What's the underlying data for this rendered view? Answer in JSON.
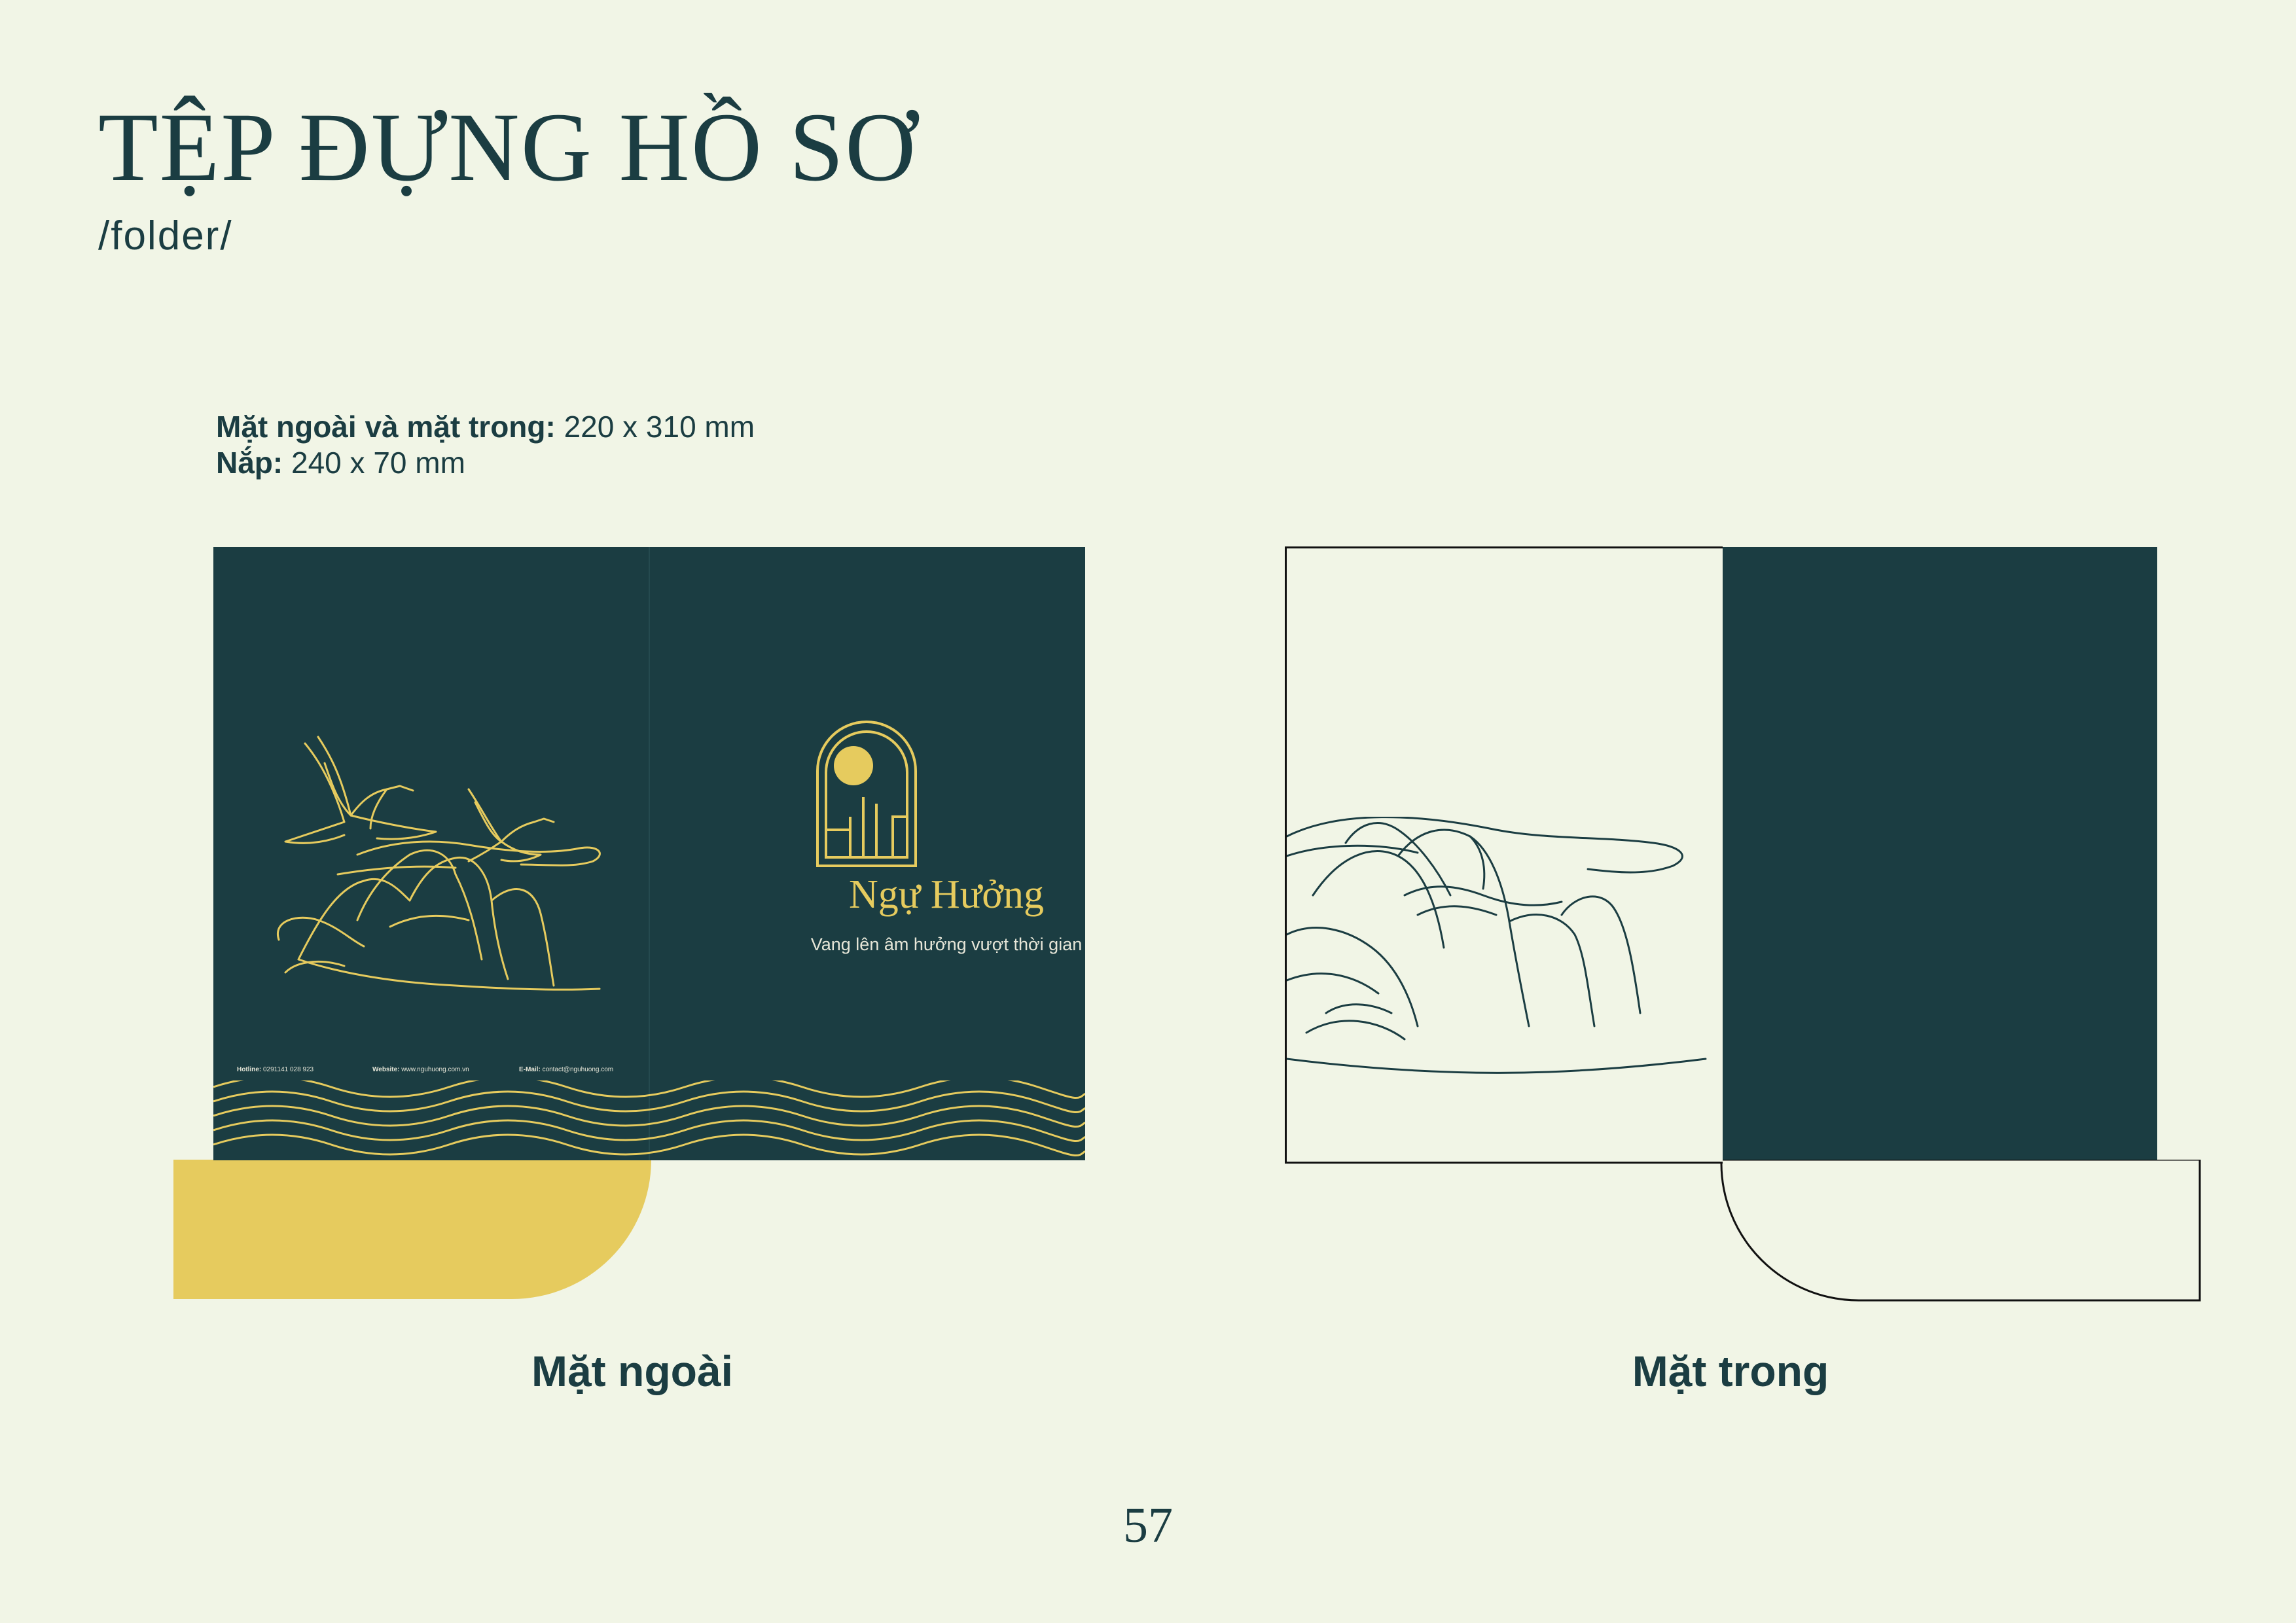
{
  "title": "TỆP ĐỰNG HỒ SƠ",
  "subtitle": "/folder/",
  "specs": {
    "size_label": "Mặt ngoài và mặt trong:",
    "size_value": "220 x 310 mm",
    "flap_label": "Nắp:",
    "flap_value": "240 x 70 mm"
  },
  "outer": {
    "hotline_label": "Hotline:",
    "hotline_value": "0291141 028 923",
    "website_label": "Website:",
    "website_value": "www.nguhuong.com.vn",
    "email_label": "E-Mail:",
    "email_value": "contact@nguhuong.com",
    "brand_name": "Ngự Hưởng",
    "tagline": "Vang lên âm hưởng vượt thời gian"
  },
  "captions": {
    "outer": "Mặt ngoài",
    "inner": "Mặt trong"
  },
  "page_number": "57",
  "colors": {
    "background": "#f1f5e6",
    "dark_teal": "#1b3d42",
    "gold": "#e6cb5e"
  }
}
